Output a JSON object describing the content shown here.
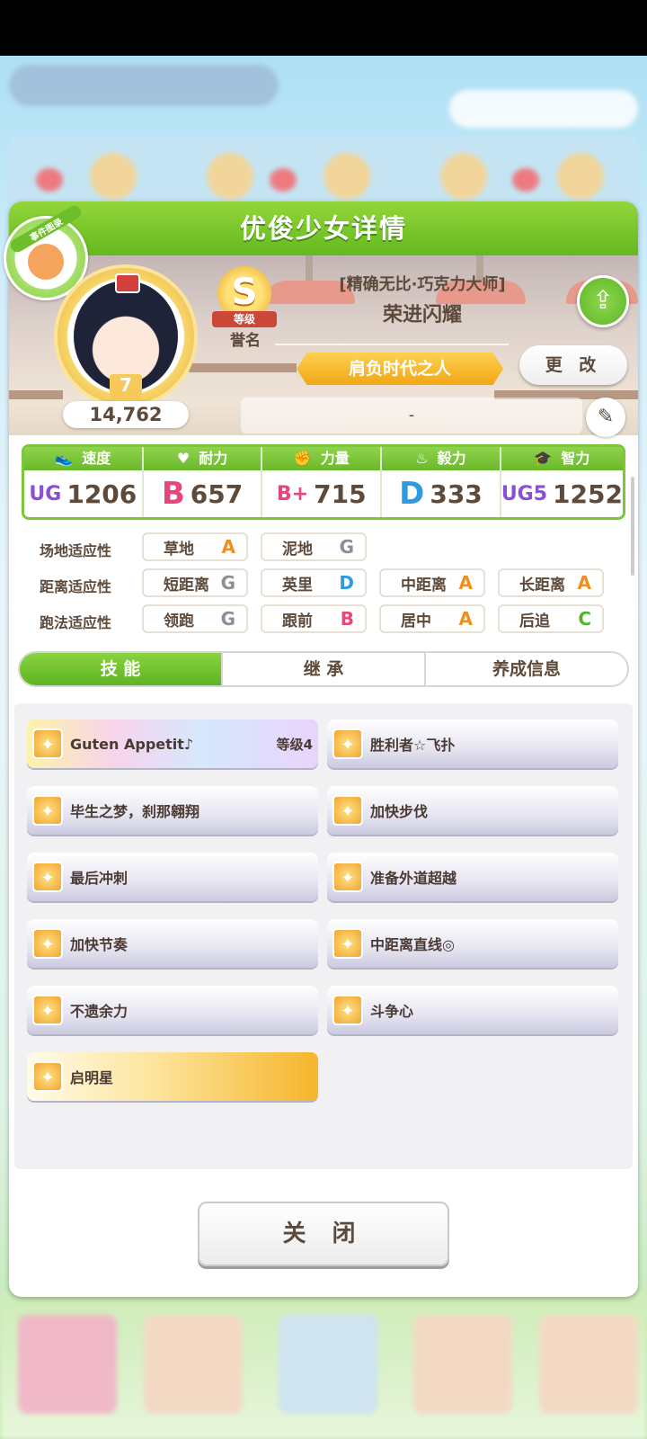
{
  "panel": {
    "title": "优俊少女详情"
  },
  "badge": {
    "label": "事件图录"
  },
  "profile": {
    "score": "14,762",
    "grade": "S",
    "grade_ribbon": "等级",
    "rank_name": "誉名",
    "epithet": "[精确无比·巧克力大师]",
    "horse_name": "荣进闪耀",
    "title_banner": "肩负时代之人",
    "change_label": "更 改",
    "name_field": "-"
  },
  "stats": [
    {
      "label": "速度",
      "icon": "shoe-icon",
      "grade": "UG",
      "value": "1206",
      "color": "#8a4fd8"
    },
    {
      "label": "耐力",
      "icon": "heart-icon",
      "grade": "B",
      "value": "657",
      "color": "#e6467a"
    },
    {
      "label": "力量",
      "icon": "muscle-icon",
      "grade": "B+",
      "value": "715",
      "color": "#e6467a"
    },
    {
      "label": "毅力",
      "icon": "flame-icon",
      "grade": "D",
      "value": "333",
      "color": "#2e9be0"
    },
    {
      "label": "智力",
      "icon": "graduation-cap-icon",
      "grade": "UG5",
      "value": "1252",
      "color": "#8a4fd8"
    }
  ],
  "aptitude": {
    "rows": [
      {
        "label": "场地适应性",
        "cells": [
          {
            "name": "草地",
            "grade": "A"
          },
          {
            "name": "泥地",
            "grade": "G"
          }
        ]
      },
      {
        "label": "距离适应性",
        "cells": [
          {
            "name": "短距离",
            "grade": "G"
          },
          {
            "name": "英里",
            "grade": "D"
          },
          {
            "name": "中距离",
            "grade": "A"
          },
          {
            "name": "长距离",
            "grade": "A"
          }
        ]
      },
      {
        "label": "跑法适应性",
        "cells": [
          {
            "name": "领跑",
            "grade": "G"
          },
          {
            "name": "跟前",
            "grade": "B"
          },
          {
            "name": "居中",
            "grade": "A"
          },
          {
            "name": "后追",
            "grade": "C"
          }
        ]
      }
    ],
    "grade_colors": {
      "A": "#f08f1e",
      "B": "#e6467a",
      "C": "#4fb52e",
      "D": "#2e9be0",
      "G": "#8f8f8f"
    }
  },
  "tabs": [
    "技 能",
    "继 承",
    "养成信息"
  ],
  "skills": [
    {
      "name": "Guten Appetit♪",
      "level": "等级4",
      "style": "rainbow"
    },
    {
      "name": "胜利者☆飞扑",
      "level": "",
      "style": "normal"
    },
    {
      "name": "毕生之梦，刹那翱翔",
      "level": "",
      "style": "normal"
    },
    {
      "name": "加快步伐",
      "level": "",
      "style": "normal"
    },
    {
      "name": "最后冲刺",
      "level": "",
      "style": "normal"
    },
    {
      "name": "准备外道超越",
      "level": "",
      "style": "normal"
    },
    {
      "name": "加快节奏",
      "level": "",
      "style": "normal"
    },
    {
      "name": "中距离直线◎",
      "level": "",
      "style": "normal"
    },
    {
      "name": "不遗余力",
      "level": "",
      "style": "normal"
    },
    {
      "name": "斗争心",
      "level": "",
      "style": "normal"
    },
    {
      "name": "启明星",
      "level": "",
      "style": "gold"
    }
  ],
  "close_label": "关 闭",
  "colors": {
    "accent_green": "#6cbf2a",
    "title_gold": "#f1a615"
  }
}
